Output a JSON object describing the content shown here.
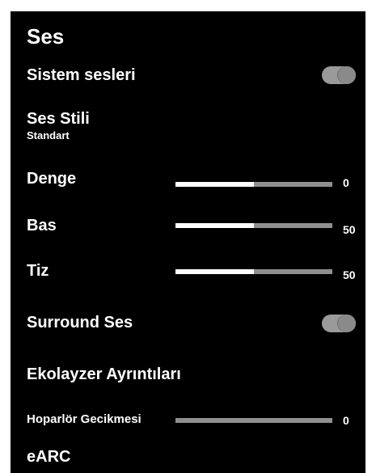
{
  "title": "Ses",
  "items": {
    "system_sounds": {
      "label": "Sistem sesleri",
      "on": true
    },
    "sound_style": {
      "label": "Ses Stili",
      "value": "Standart"
    },
    "balance": {
      "label": "Denge",
      "value": "0",
      "fill": 0.5
    },
    "bass": {
      "label": "Bas",
      "value": "50",
      "fill": 0.5
    },
    "treble": {
      "label": "Tiz",
      "value": "50",
      "fill": 0.5
    },
    "surround": {
      "label": "Surround Ses",
      "on": true
    },
    "equalizer": {
      "label": "Ekolayzer Ayrıntıları"
    },
    "speaker_delay": {
      "label": "Hoparlör Gecikmesi",
      "value": "0",
      "fill": 0
    },
    "earc": {
      "label": "eARC"
    }
  },
  "colors": {
    "background": "#000000",
    "text": "#ffffff",
    "track": "#8f8f8f",
    "fill": "#ffffff",
    "toggle": "#9a9a9a"
  }
}
